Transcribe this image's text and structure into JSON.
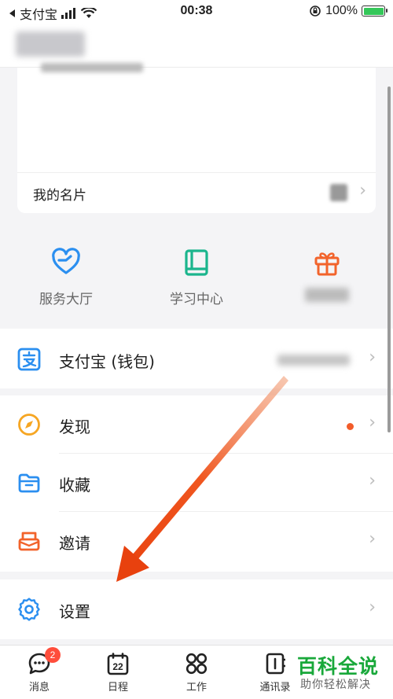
{
  "status_bar": {
    "carrier": "支付宝",
    "time": "00:38",
    "battery": "100%"
  },
  "profile_card": {
    "namecard_label": "我的名片"
  },
  "shortcuts": [
    {
      "label": "服务大厅",
      "icon": "heart-hand-icon"
    },
    {
      "label": "学习中心",
      "icon": "book-icon"
    },
    {
      "label": "",
      "icon": "gift-icon"
    }
  ],
  "menu": {
    "wallet": {
      "label": "支付宝 (钱包)",
      "icon": "alipay-icon"
    },
    "discover": {
      "label": "发现",
      "icon": "compass-icon",
      "has_dot": true
    },
    "favorites": {
      "label": "收藏",
      "icon": "folder-icon"
    },
    "invite": {
      "label": "邀请",
      "icon": "invite-icon"
    },
    "settings": {
      "label": "设置",
      "icon": "gear-icon"
    }
  },
  "tabbar": {
    "tabs": [
      {
        "label": "消息",
        "icon": "chat-icon",
        "badge": "2"
      },
      {
        "label": "日程",
        "icon": "calendar-icon",
        "day": "22"
      },
      {
        "label": "工作",
        "icon": "grid-icon"
      },
      {
        "label": "通讯录",
        "icon": "contacts-icon"
      }
    ]
  },
  "watermark": {
    "main": "百科全说",
    "sub": "助你轻松解决"
  },
  "colors": {
    "blue": "#2b8ff0",
    "teal": "#1bb58d",
    "orange": "#f2632b",
    "compass": "#f6a623",
    "arrow": "#f0561f"
  }
}
